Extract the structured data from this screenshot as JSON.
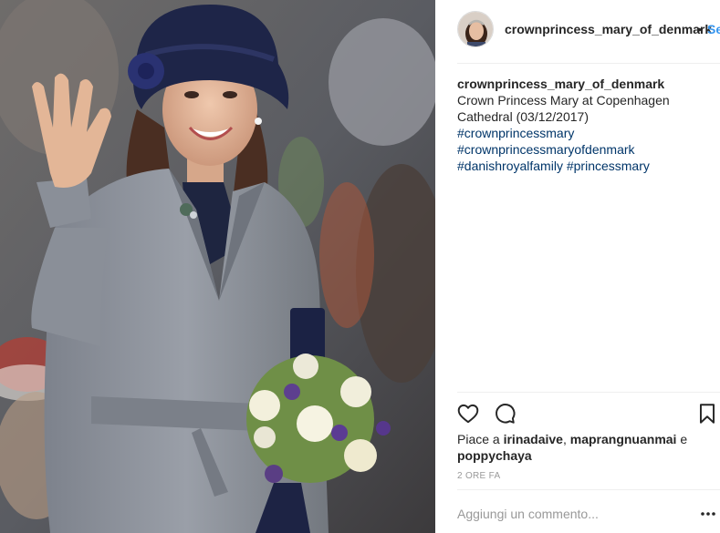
{
  "post": {
    "username": "crownprincess_mary_of_denmark",
    "dot": "•",
    "follow_label": "Se",
    "caption": {
      "username": "crownprincess_mary_of_denmark",
      "text": "Crown Princess Mary at Copenhagen Cathedral (03/12/2017)",
      "hashtags": [
        "#crownprincessmary",
        "#crownprincessmaryofdenmark",
        "#danishroyalfamily",
        "#princessmary"
      ]
    },
    "likes": {
      "prefix": "Piace a",
      "user1": "irinadaive",
      "separator": ",",
      "user2": "maprangnuanmai",
      "conjunction": "e",
      "user3": "poppychaya"
    },
    "timestamp": "2 ORE FA",
    "comment_placeholder": "Aggiungi un commento..."
  },
  "icons": {
    "heart": "heart-icon",
    "comment": "comment-icon",
    "save": "bookmark-icon",
    "more": "more-options-icon"
  },
  "colors": {
    "link": "#3897f0",
    "hashtag": "#003569",
    "text": "#262626",
    "muted": "#999999",
    "divider": "#efefef",
    "coat": "#8e949e",
    "hat": "#1e2548"
  }
}
